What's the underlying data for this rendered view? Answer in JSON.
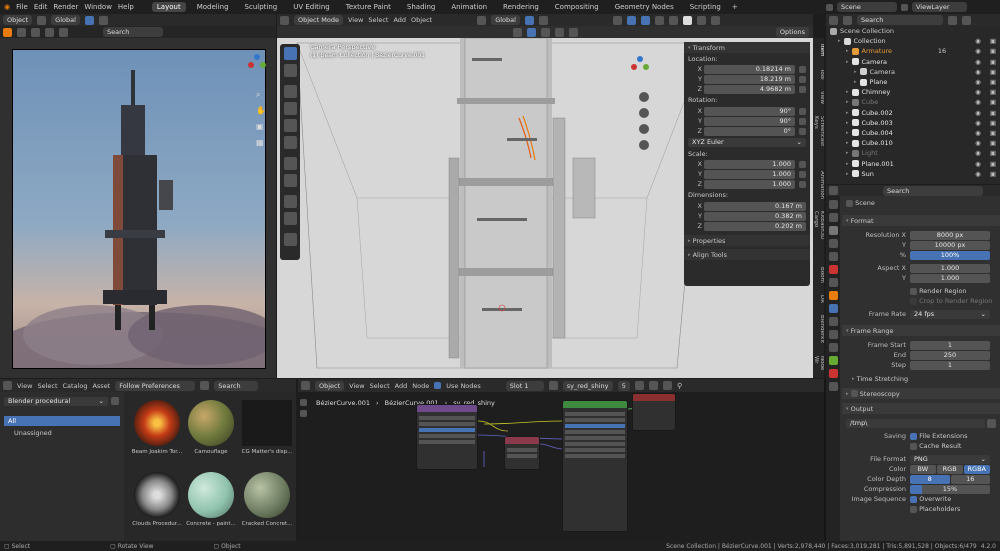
{
  "menus": [
    "File",
    "Edit",
    "Render",
    "Window",
    "Help"
  ],
  "workspaces": [
    "Layout",
    "Modeling",
    "Sculpting",
    "UV Editing",
    "Texture Paint",
    "Shading",
    "Animation",
    "Rendering",
    "Compositing",
    "Geometry Nodes",
    "Scripting"
  ],
  "active_workspace": "Layout",
  "scene": {
    "label": "Scene",
    "view_layer": "ViewLayer"
  },
  "left_header": {
    "mode": "Object",
    "orientation": "Global",
    "search_placeholder": "Search"
  },
  "viewport": {
    "mode": "Object Mode",
    "menus": [
      "View",
      "Select",
      "Add",
      "Object"
    ],
    "orientation": "Global",
    "overlay_title": "Camera Perspective",
    "overlay_subtitle": "(1) Beam Collection | BézierCurve.001",
    "options": "Options",
    "side_tabs": [
      "Item",
      "Tool",
      "View",
      "Screencast Keys",
      "Animation",
      "KitBash3D Cargo",
      "Boom",
      "DR",
      "Blenderkit",
      "Node Wr"
    ]
  },
  "transform": {
    "title": "Transform",
    "location_label": "Location:",
    "location": [
      {
        "axis": "X",
        "value": "0.18214 m"
      },
      {
        "axis": "Y",
        "value": "18.219 m"
      },
      {
        "axis": "Z",
        "value": "4.9682 m"
      }
    ],
    "rotation_label": "Rotation:",
    "rotation": [
      {
        "axis": "X",
        "value": "90°"
      },
      {
        "axis": "Y",
        "value": "90°"
      },
      {
        "axis": "Z",
        "value": "0°"
      }
    ],
    "rotation_mode": "XYZ Euler",
    "scale_label": "Scale:",
    "scale": [
      {
        "axis": "X",
        "value": "1.000"
      },
      {
        "axis": "Y",
        "value": "1.000"
      },
      {
        "axis": "Z",
        "value": "1.000"
      }
    ],
    "dimensions_label": "Dimensions:",
    "dimensions": [
      {
        "axis": "X",
        "value": "0.167 m"
      },
      {
        "axis": "Y",
        "value": "0.382 m"
      },
      {
        "axis": "Z",
        "value": "0.202 m"
      }
    ],
    "properties": "Properties",
    "align_tools": "Align Tools"
  },
  "outliner": {
    "search_placeholder": "Search",
    "root": "Scene Collection",
    "items": [
      {
        "name": "Collection",
        "indent": 1,
        "color": "#d9d9d9",
        "icon": "collection-icon"
      },
      {
        "name": "Armature",
        "indent": 2,
        "color": "#e49a3a",
        "icon": "armature-icon",
        "count": "16"
      },
      {
        "name": "Camera",
        "indent": 2,
        "color": "#e4e4e4",
        "icon": "camera-icon"
      },
      {
        "name": "Camera",
        "indent": 3,
        "color": "#d0d0d0",
        "icon": "camera-data-icon"
      },
      {
        "name": "Plane",
        "indent": 3,
        "color": "#e4e4e4",
        "icon": "plane-icon"
      },
      {
        "name": "Chimney",
        "indent": 2,
        "color": "#e4e4e4",
        "icon": "mesh-icon"
      },
      {
        "name": "Cube",
        "indent": 2,
        "color": "#777",
        "icon": "mesh-icon"
      },
      {
        "name": "Cube.002",
        "indent": 2,
        "color": "#e4e4e4",
        "icon": "mesh-icon"
      },
      {
        "name": "Cube.003",
        "indent": 2,
        "color": "#e4e4e4",
        "icon": "mesh-icon"
      },
      {
        "name": "Cube.004",
        "indent": 2,
        "color": "#e4e4e4",
        "icon": "mesh-icon"
      },
      {
        "name": "Cube.010",
        "indent": 2,
        "color": "#e4e4e4",
        "icon": "mesh-icon"
      },
      {
        "name": "Light",
        "indent": 2,
        "color": "#777",
        "icon": "light-icon"
      },
      {
        "name": "Plane.001",
        "indent": 2,
        "color": "#e4e4e4",
        "icon": "mesh-icon"
      },
      {
        "name": "Sun",
        "indent": 2,
        "color": "#e4e4e4",
        "icon": "sun-icon"
      }
    ]
  },
  "properties": {
    "search_placeholder": "Search",
    "context": "Scene",
    "format_title": "Format",
    "resolution_x_label": "Resolution X",
    "resolution_x": "8000 px",
    "resolution_y_label": "Y",
    "resolution_y": "10000 px",
    "percent_label": "%",
    "percent": "100%",
    "aspect_x_label": "Aspect X",
    "aspect_x": "1.000",
    "aspect_y_label": "Y",
    "aspect_y": "1.000",
    "render_region": "Render Region",
    "crop_region": "Crop to Render Region",
    "frame_rate_label": "Frame Rate",
    "frame_rate": "24 fps",
    "frame_range_title": "Frame Range",
    "frame_start_label": "Frame Start",
    "frame_start": "1",
    "end_label": "End",
    "end": "250",
    "step_label": "Step",
    "step": "1",
    "time_stretching": "Time Stretching",
    "stereoscopy": "Stereoscopy",
    "output_title": "Output",
    "output_path": "/tmp\\",
    "saving_label": "Saving",
    "file_extensions": "File Extensions",
    "cache_result": "Cache Result",
    "file_format_label": "File Format",
    "file_format": "PNG",
    "color_label": "Color",
    "color_options": [
      "BW",
      "RGB",
      "RGBA"
    ],
    "color_selected": "RGBA",
    "color_depth_label": "Color Depth",
    "color_depth_options": [
      "8",
      "16"
    ],
    "color_depth_selected": "8",
    "compression_label": "Compression",
    "compression": "15%",
    "compression_level": 0.15,
    "image_sequence_label": "Image Sequence",
    "overwrite": "Overwrite",
    "placeholders": "Placeholders"
  },
  "asset_browser": {
    "menus": [
      "View",
      "Select",
      "Catalog",
      "Asset"
    ],
    "follow": "Follow Preferences",
    "search_placeholder": "Search",
    "library": "Blender procedural",
    "catalogs": [
      "All",
      "Unassigned"
    ],
    "assets": [
      "Beam Joakim Tor...",
      "Camouflage",
      "CG Matter's disp...",
      "Clouds Procedur...",
      "Concrete - paint...",
      "Cracked Concret..."
    ]
  },
  "node_editor": {
    "type": "Object",
    "menus": [
      "View",
      "Select",
      "Add",
      "Node"
    ],
    "use_nodes": "Use Nodes",
    "slot": "Slot 1",
    "material": "sy_red_shiny",
    "users": "5",
    "breadcrumb": [
      "BézierCurve.001",
      "BézierCurve.001",
      "sy_red_shiny"
    ]
  },
  "statusbar": {
    "left": [
      "Select",
      "Rotate View",
      "Object"
    ],
    "stats": "Scene Collection | BézierCurve.001 | Verts:2,978,440 | Faces:3,019,281 | Tris:5,891,528 | Objects:6/479",
    "version": "4.2.0"
  }
}
